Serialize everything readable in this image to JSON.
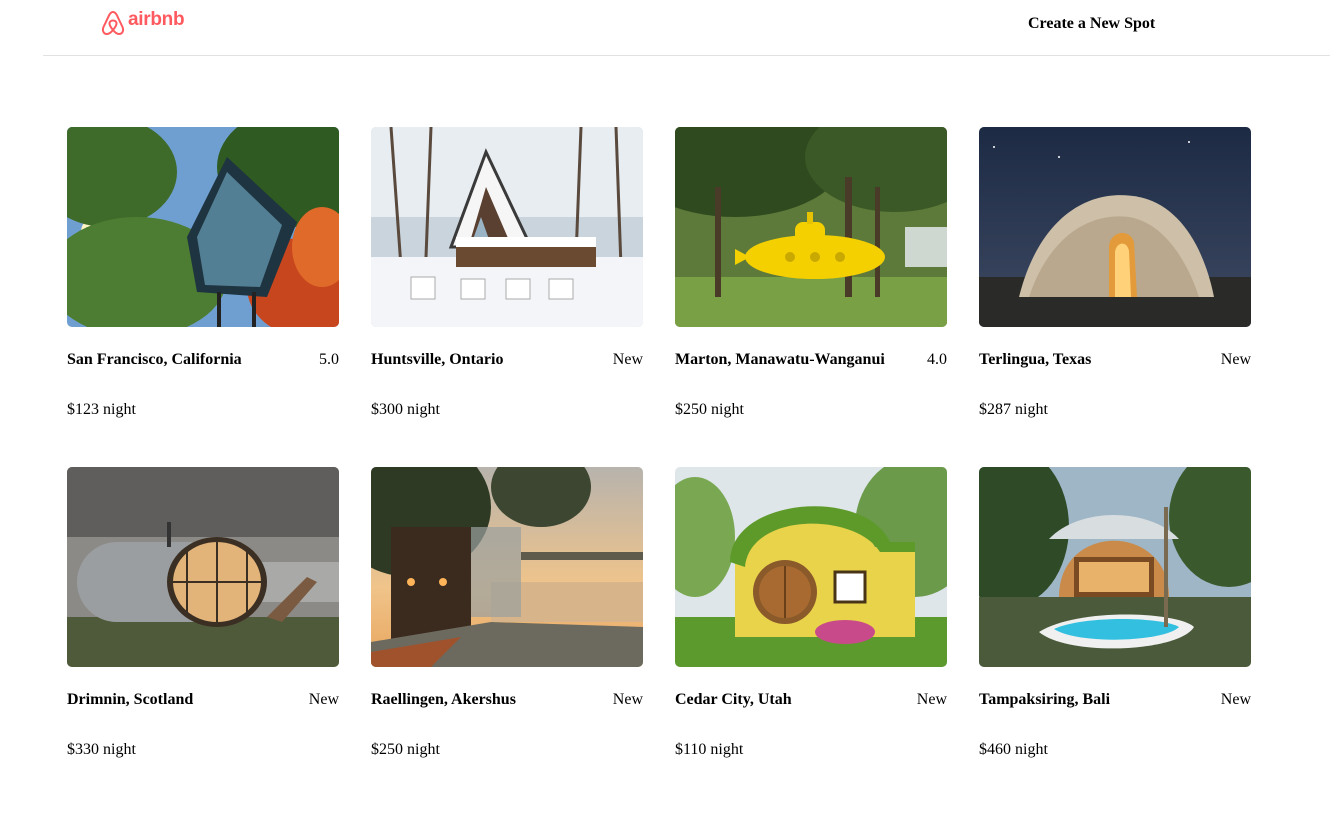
{
  "header": {
    "logo_text": "airbnb",
    "brand_color": "#ff5a5f",
    "create_spot_label": "Create a New Spot"
  },
  "spots": [
    {
      "location": "San Francisco, California",
      "rating": "5.0",
      "price": "$123 night",
      "image": "glass-treehouse-in-forest"
    },
    {
      "location": "Huntsville, Ontario",
      "rating": "New",
      "price": "$300 night",
      "image": "a-frame-cabin-in-snow"
    },
    {
      "location": "Marton, Manawatu-Wanganui",
      "rating": "4.0",
      "price": "$250 night",
      "image": "yellow-submarine-under-trees"
    },
    {
      "location": "Terlingua, Texas",
      "rating": "New",
      "price": "$287 night",
      "image": "earthen-dome-at-night"
    },
    {
      "location": "Drimnin, Scotland",
      "rating": "New",
      "price": "$330 night",
      "image": "glass-pod-by-loch"
    },
    {
      "location": "Raellingen, Akershus",
      "rating": "New",
      "price": "$250 night",
      "image": "mirror-cabin-by-lake-at-sunset"
    },
    {
      "location": "Cedar City, Utah",
      "rating": "New",
      "price": "$110 night",
      "image": "hobbit-house-with-grass-roof"
    },
    {
      "location": "Tampaksiring, Bali",
      "rating": "New",
      "price": "$460 night",
      "image": "bamboo-villa-with-pool"
    }
  ]
}
